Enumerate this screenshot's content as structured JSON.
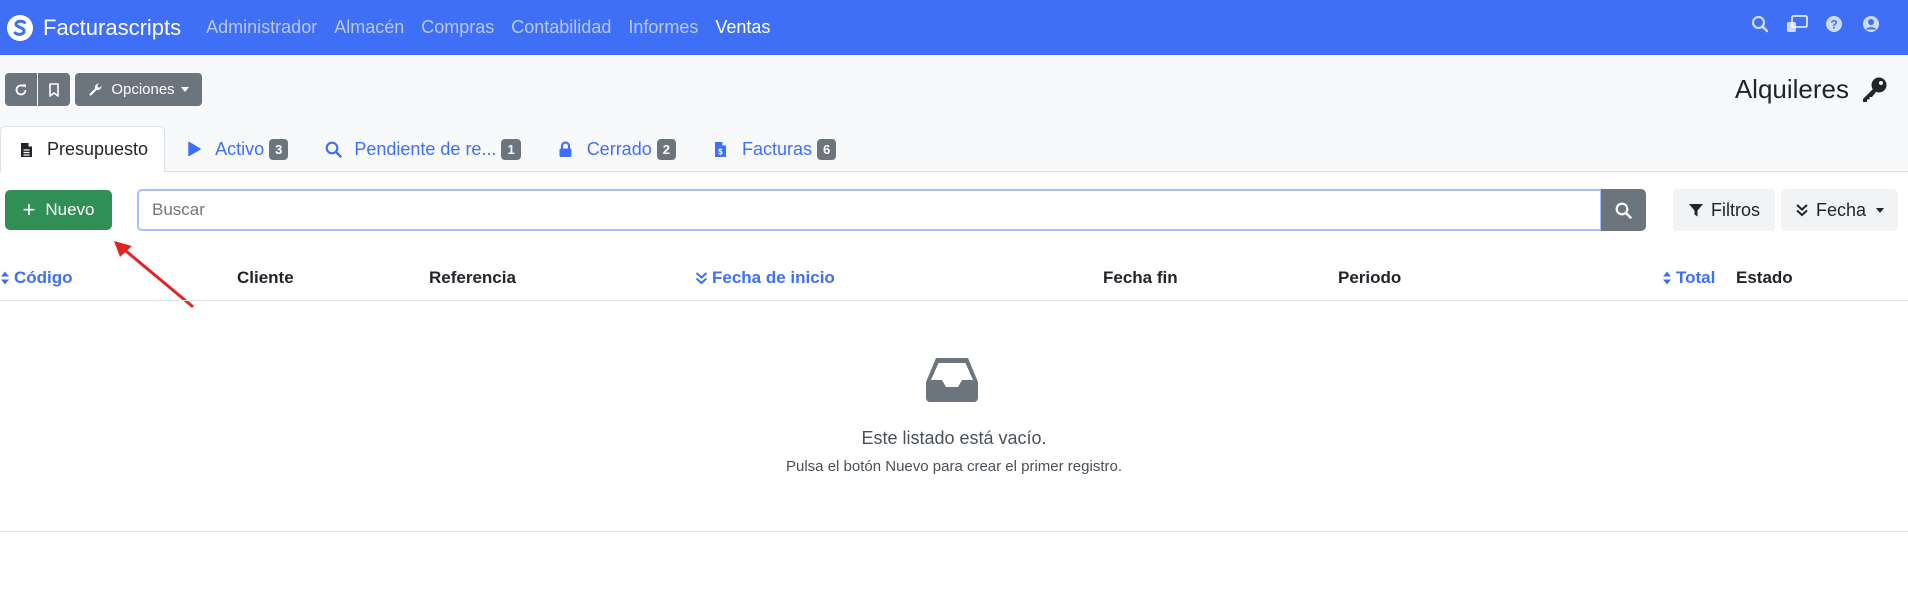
{
  "navbar": {
    "brand": "Facturascripts",
    "menu": [
      "Administrador",
      "Almacén",
      "Compras",
      "Contabilidad",
      "Informes",
      "Ventas"
    ],
    "active_menu": "Ventas",
    "right_icons": [
      "search-icon",
      "remote-desktop-icon",
      "help-icon",
      "user-icon"
    ]
  },
  "toolbar": {
    "options_label": "Opciones",
    "page_title": "Alquileres"
  },
  "tabs": [
    {
      "label": "Presupuesto",
      "icon": "document-icon",
      "badge": ""
    },
    {
      "label": "Activo",
      "icon": "play-icon",
      "badge": "3"
    },
    {
      "label": "Pendiente de re...",
      "icon": "search-icon",
      "badge": "1"
    },
    {
      "label": "Cerrado",
      "icon": "lock-icon",
      "badge": "2"
    },
    {
      "label": "Facturas",
      "icon": "invoice-icon",
      "badge": "6"
    }
  ],
  "search": {
    "new_label": "Nuevo",
    "placeholder": "Buscar",
    "filters_label": "Filtros",
    "order_label": "Fecha"
  },
  "table": {
    "columns": [
      "Código",
      "Cliente",
      "Referencia",
      "Fecha de inicio",
      "Fecha fin",
      "Periodo",
      "Total",
      "Estado"
    ]
  },
  "empty": {
    "title": "Este listado está vacío.",
    "subtitle": "Pulsa el botón Nuevo para crear el primer registro."
  },
  "colors": {
    "primary": "#3f6ff7",
    "success": "#2f8f55",
    "secondary": "#6c757d",
    "annotation": "#e02424"
  }
}
